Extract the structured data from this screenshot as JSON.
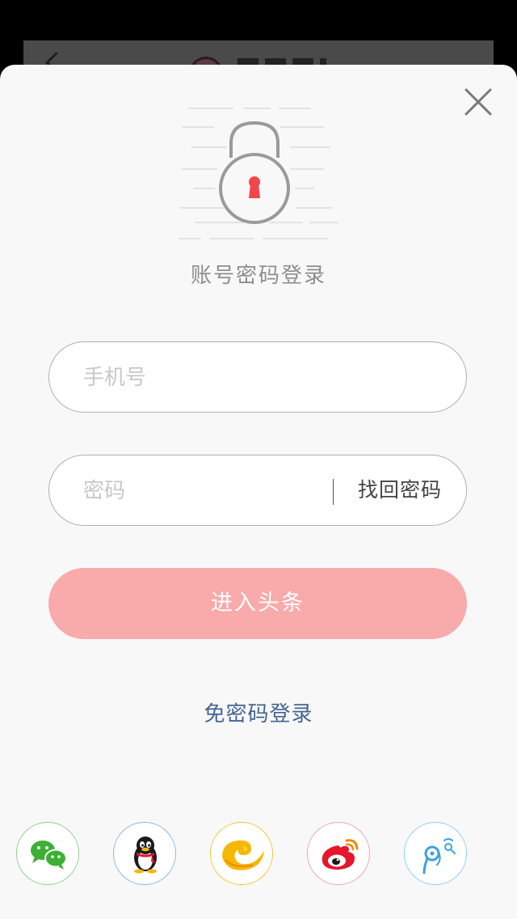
{
  "header": {
    "title": "账号密码登录"
  },
  "form": {
    "phone_placeholder": "手机号",
    "password_placeholder": "密码",
    "forgot_label": "找回密码",
    "submit_label": "进入头条"
  },
  "alt_login": {
    "label": "免密码登录"
  },
  "social": {
    "items": [
      {
        "name": "wechat-icon",
        "color": "#3cb034"
      },
      {
        "name": "qq-icon",
        "color": "#1a1a1a"
      },
      {
        "name": "tianyi-icon",
        "color": "#f5b800"
      },
      {
        "name": "weibo-icon",
        "color": "#e6162d"
      },
      {
        "name": "tencent-weibo-icon",
        "color": "#3aa2dc"
      }
    ]
  },
  "colors": {
    "accent": "#f9aaaa",
    "link": "#436591",
    "lock_keyhole": "#f2464a"
  }
}
